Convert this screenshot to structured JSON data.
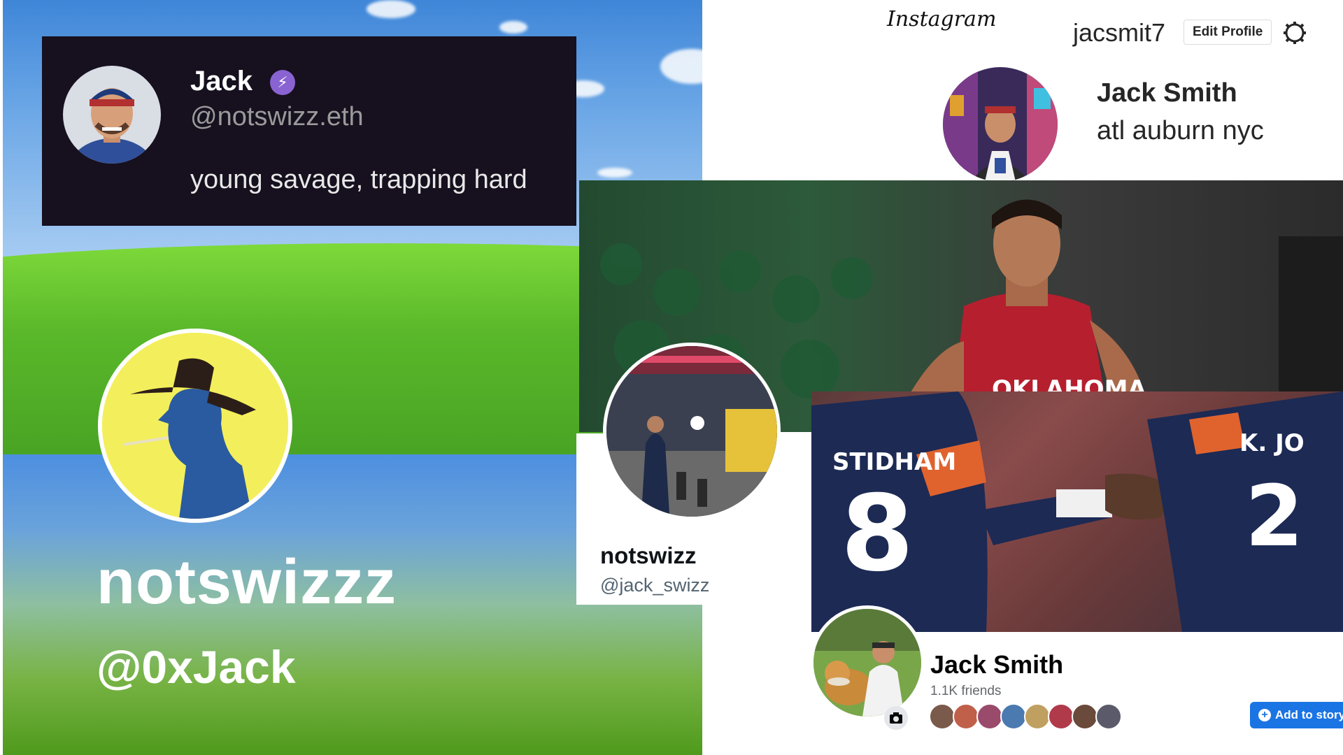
{
  "farcaster": {
    "name": "Jack",
    "handle": "@notswizz.eth",
    "bio": "young savage, trapping hard",
    "badge_color": "#8a63d2",
    "badge_icon": "lightning-bolt-icon"
  },
  "lens": {
    "name": "notswizzz",
    "handle": "@0xJack"
  },
  "instagram": {
    "logo": "Instagram",
    "username": "jacsmit7",
    "edit_profile_label": "Edit Profile",
    "settings_icon": "gear-icon",
    "full_name": "Jack Smith",
    "bio": "atl auburn nyc"
  },
  "twitter": {
    "name": "notswizz",
    "handle": "@jack_swizz"
  },
  "banners": {
    "basketball_jersey_text": "OKLAHOMA",
    "football_left_name": "STIDHAM",
    "football_left_number": "8",
    "football_right_name": "K. JO",
    "football_right_number": "2"
  },
  "facebook": {
    "name": "Jack Smith",
    "friends": "1.1K friends",
    "add_story_label": "Add to story",
    "accent": "#1b74e4",
    "friend_avatar_colors": [
      "#7a5a4a",
      "#c0604a",
      "#9a4a6a",
      "#4a7ab0",
      "#c0a060",
      "#b03a4a",
      "#6a4a3a",
      "#5a5a6a"
    ]
  }
}
